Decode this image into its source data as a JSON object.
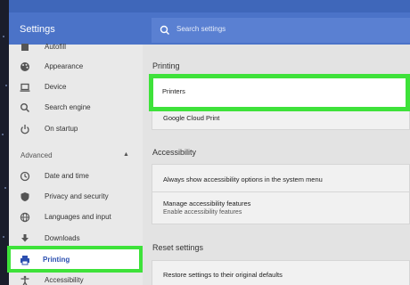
{
  "header": {
    "title": "Settings",
    "search_placeholder": "Search settings"
  },
  "sidebar": {
    "items": [
      {
        "label": "Autofill",
        "icon": "autofill-icon"
      },
      {
        "label": "Appearance",
        "icon": "palette-icon"
      },
      {
        "label": "Device",
        "icon": "laptop-icon"
      },
      {
        "label": "Search engine",
        "icon": "search-icon"
      },
      {
        "label": "On startup",
        "icon": "power-icon"
      }
    ],
    "advanced_label": "Advanced",
    "advanced_items": [
      {
        "label": "Date and time",
        "icon": "clock-icon"
      },
      {
        "label": "Privacy and security",
        "icon": "shield-icon"
      },
      {
        "label": "Languages and input",
        "icon": "globe-icon"
      },
      {
        "label": "Downloads",
        "icon": "download-icon"
      },
      {
        "label": "Printing",
        "icon": "printer-icon"
      },
      {
        "label": "Accessibility",
        "icon": "accessibility-icon"
      }
    ]
  },
  "main": {
    "printing": {
      "title": "Printing",
      "printers": "Printers",
      "cloud_print": "Google Cloud Print"
    },
    "accessibility": {
      "title": "Accessibility",
      "always_show": "Always show accessibility options in the system menu",
      "manage": "Manage accessibility features",
      "manage_sub": "Enable accessibility features"
    },
    "reset": {
      "title": "Reset settings",
      "restore": "Restore settings to their original defaults"
    }
  },
  "colors": {
    "header": "#4b73c8",
    "highlight": "#3ee23a",
    "active_text": "#2b4fb0"
  }
}
